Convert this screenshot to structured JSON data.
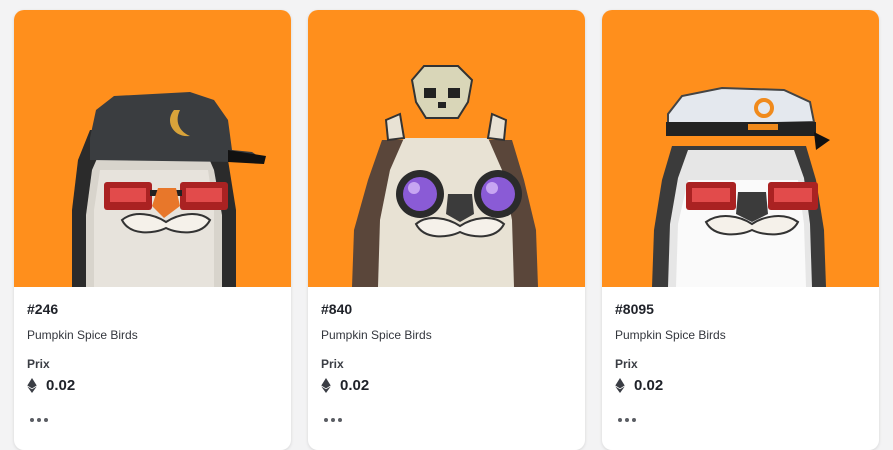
{
  "colors": {
    "card_bg": "#ff8f1c",
    "accent": "#ff8f1c"
  },
  "cards": [
    {
      "token_id": "#246",
      "collection": "Pumpkin Spice Birds",
      "price_label": "Prix",
      "price": "0.02",
      "icon": "ethereum-icon",
      "more_icon": "more-options-icon"
    },
    {
      "token_id": "#840",
      "collection": "Pumpkin Spice Birds",
      "price_label": "Prix",
      "price": "0.02",
      "icon": "ethereum-icon",
      "more_icon": "more-options-icon"
    },
    {
      "token_id": "#8095",
      "collection": "Pumpkin Spice Birds",
      "price_label": "Prix",
      "price": "0.02",
      "icon": "ethereum-icon",
      "more_icon": "more-options-icon"
    }
  ]
}
